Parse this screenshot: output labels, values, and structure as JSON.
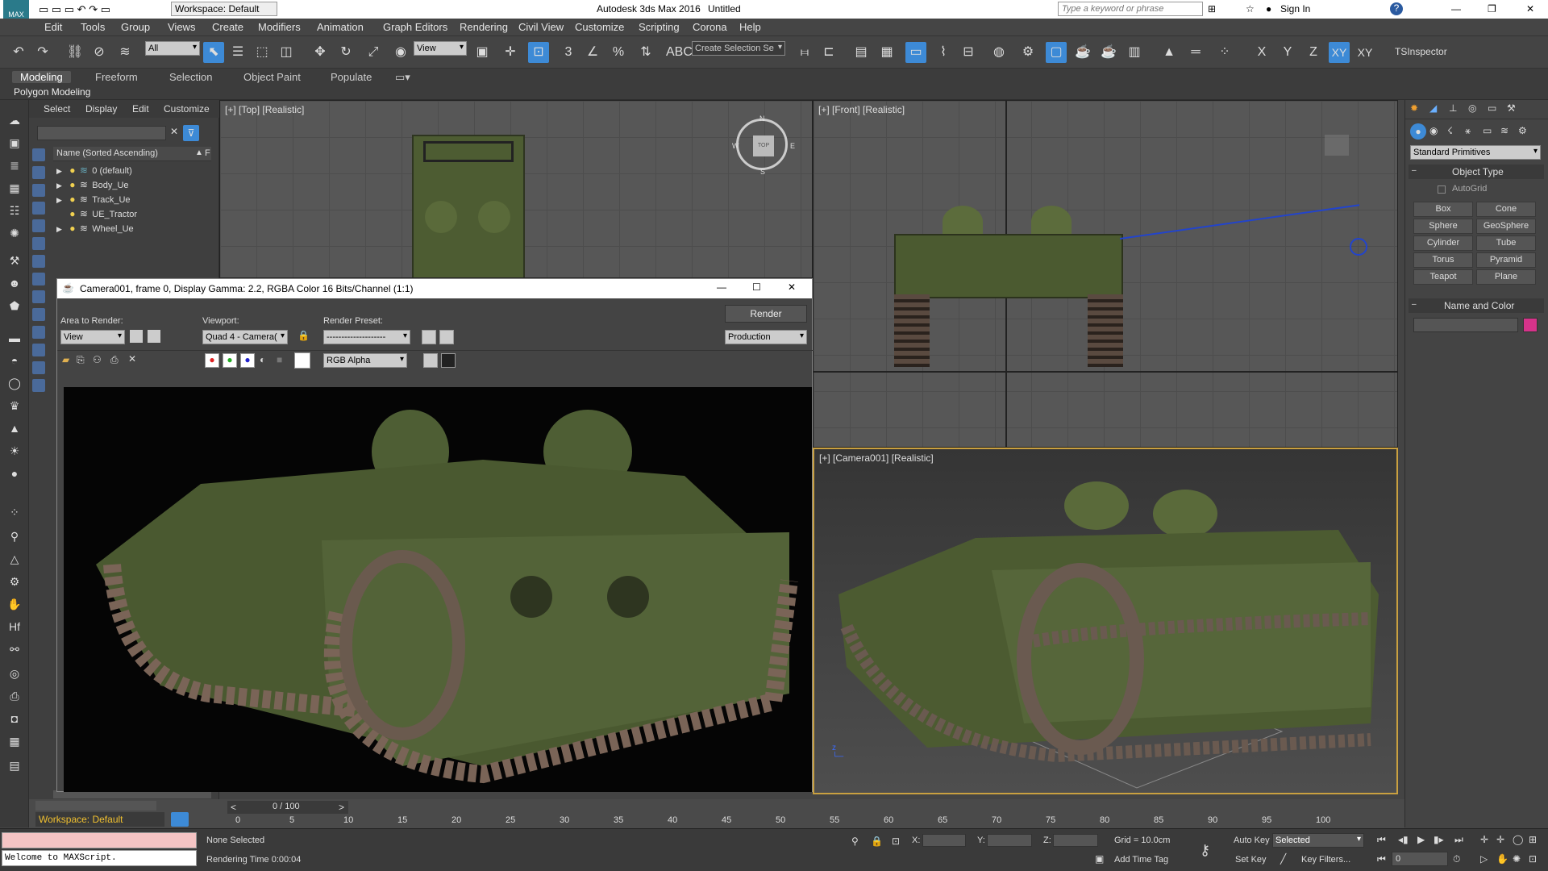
{
  "app": {
    "title": "Autodesk 3ds Max 2016",
    "document": "Untitled",
    "workspace": "Workspace: Default",
    "search_placeholder": "Type a keyword or phrase",
    "sign_in": "Sign In"
  },
  "menu": [
    "Edit",
    "Tools",
    "Group",
    "Views",
    "Create",
    "Modifiers",
    "Animation",
    "Graph Editors",
    "Rendering",
    "Civil View",
    "Customize",
    "Scripting",
    "Corona",
    "Help"
  ],
  "toolbar": {
    "selection_filter": "All",
    "ref_coord": "View",
    "selection_set_placeholder": "Create Selection Se",
    "axes": [
      "X",
      "Y",
      "Z",
      "XY",
      "XY"
    ],
    "tsinspector": "TSInspector"
  },
  "ribbon": {
    "tabs": [
      "Modeling",
      "Freeform",
      "Selection",
      "Object Paint",
      "Populate"
    ],
    "sub": "Polygon Modeling"
  },
  "scene_explorer": {
    "menu": [
      "Select",
      "Display",
      "Edit",
      "Customize"
    ],
    "column": "Name (Sorted Ascending)",
    "column2": "F",
    "items": [
      "0 (default)",
      "Body_Ue",
      "Track_Ue",
      "UE_Tractor",
      "Wheel_Ue"
    ],
    "workspace": "Workspace: Default"
  },
  "viewports": {
    "top": "[+] [Top] [Realistic]",
    "front": "[+] [Front] [Realistic]",
    "camera": "[+] [Camera001] [Realistic]",
    "viewcube_top": "TOP",
    "compass": {
      "n": "N",
      "s": "S",
      "e": "E",
      "w": "W"
    }
  },
  "render_window": {
    "title": "Camera001, frame 0, Display Gamma: 2.2, RGBA Color 16 Bits/Channel (1:1)",
    "area_label": "Area to Render:",
    "area_value": "View",
    "viewport_label": "Viewport:",
    "viewport_value": "Quad 4 - Camera(",
    "preset_label": "Render Preset:",
    "preset_value": "--------------------",
    "render_button": "Render",
    "production": "Production",
    "channel": "RGB Alpha"
  },
  "command_panel": {
    "category": "Standard Primitives",
    "object_type": "Object Type",
    "autogrid": "AutoGrid",
    "buttons": [
      "Box",
      "Cone",
      "Sphere",
      "GeoSphere",
      "Cylinder",
      "Tube",
      "Torus",
      "Pyramid",
      "Teapot",
      "Plane"
    ],
    "name_color": "Name and Color",
    "color": "#d6338a"
  },
  "timeline": {
    "frame": "0 / 100",
    "ticks": [
      "0",
      "5",
      "10",
      "15",
      "20",
      "25",
      "30",
      "35",
      "40",
      "45",
      "50",
      "55",
      "60",
      "65",
      "70",
      "75",
      "80",
      "85",
      "90",
      "95",
      "100"
    ]
  },
  "status": {
    "maxscript": "Welcome to MAXScript.",
    "selection": "None Selected",
    "rendering_time": "Rendering Time  0:00:04",
    "x_label": "X:",
    "y_label": "Y:",
    "z_label": "Z:",
    "grid": "Grid = 10.0cm",
    "add_time_tag": "Add Time Tag",
    "auto_key": "Auto Key",
    "set_key": "Set Key",
    "key_mode": "Selected",
    "key_filters": "Key Filters...",
    "frame_value": "0"
  }
}
